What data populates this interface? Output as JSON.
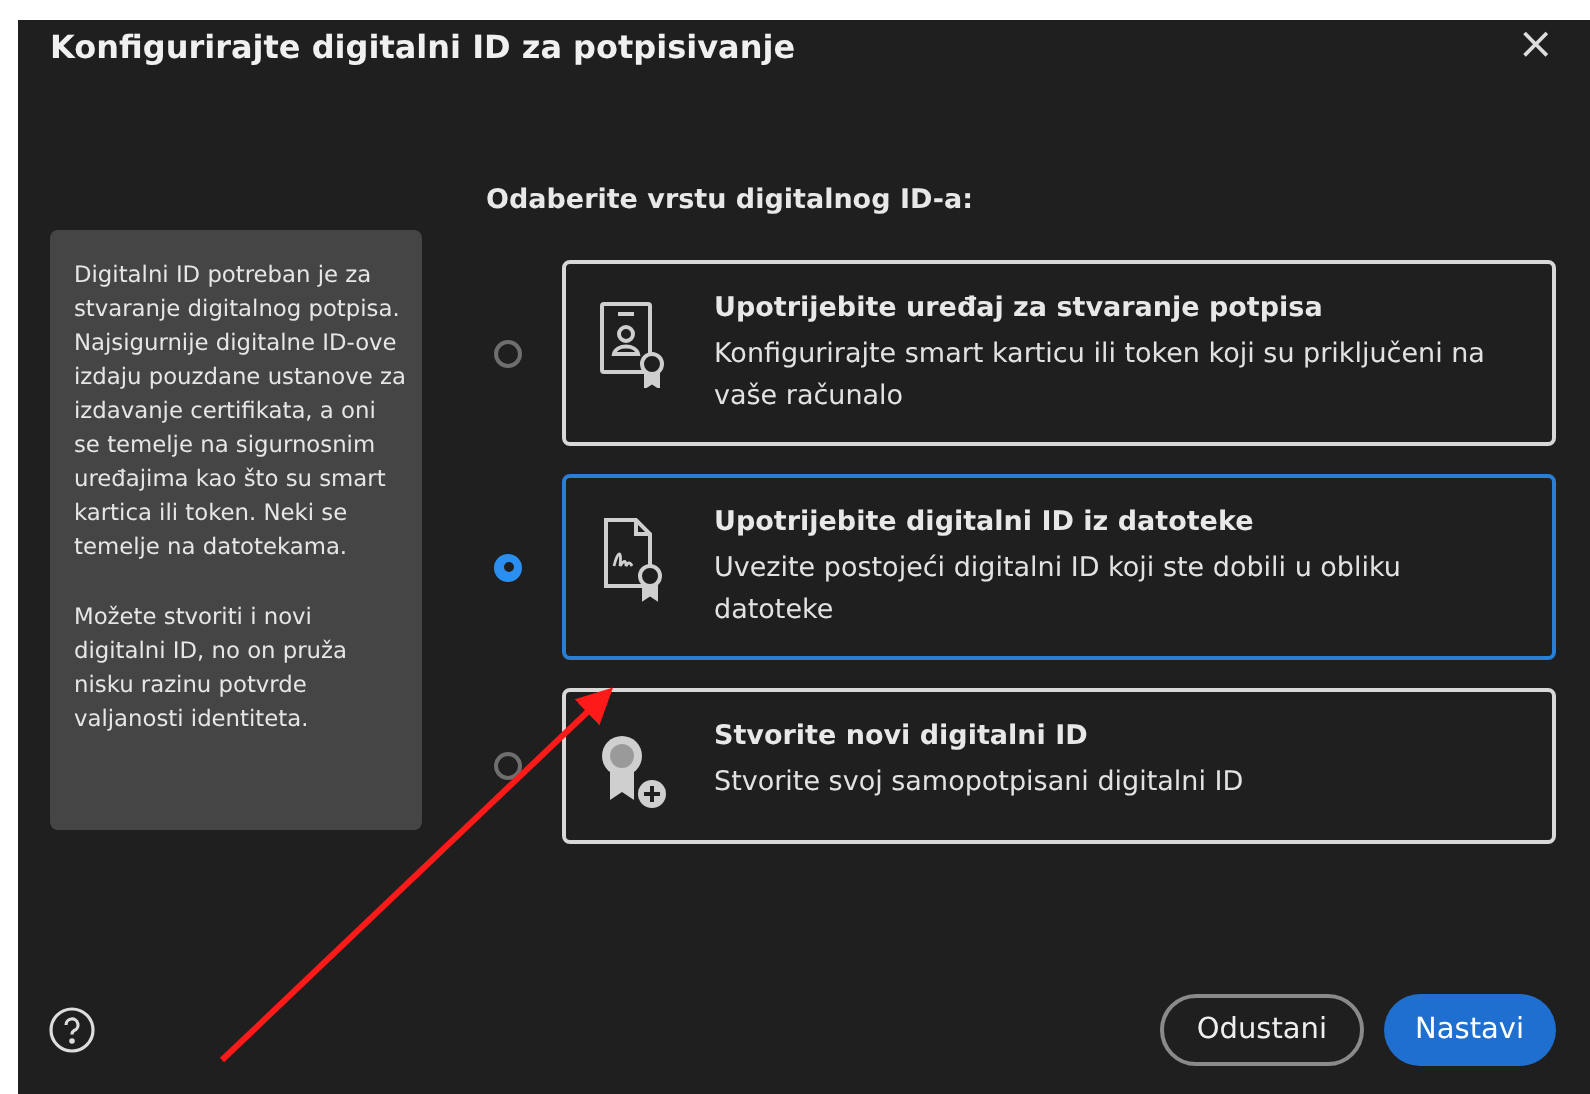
{
  "window": {
    "title": "Konfigurirajte digitalni ID za potpisivanje",
    "close": "×"
  },
  "info_panel": {
    "paragraphs": [
      "Digitalni ID potreban je za stvaranje digitalnog potpisa. Najsigurnije digitalne ID-ove izdaju pouzdane ustanove za izdavanje certifikata, a oni se temelje na sigurnosnim uređajima kao što su smart kartica ili token. Neki se temelje na datotekama.",
      "Možete stvoriti i novi digitalni ID, no on pruža nisku razinu potvrde valjanosti identiteta."
    ]
  },
  "heading": "Odaberite vrstu digitalnog ID-a:",
  "options": [
    {
      "kind": "device",
      "title": "Upotrijebite uređaj za stvaranje potpisa",
      "description": "Konfigurirajte smart karticu ili token koji su priključeni na vaše računalo",
      "selected": false
    },
    {
      "kind": "file",
      "title": "Upotrijebite digitalni ID iz datoteke",
      "description": "Uvezite postojeći digitalni ID koji ste dobili u obliku datoteke",
      "selected": true
    },
    {
      "kind": "new",
      "title": "Stvorite novi digitalni ID",
      "description": "Stvorite svoj samopotpisani digitalni ID",
      "selected": false
    }
  ],
  "buttons": [
    {
      "kind": "secondary",
      "label": "Odustani"
    },
    {
      "kind": "primary",
      "label": "Nastavi"
    }
  ]
}
